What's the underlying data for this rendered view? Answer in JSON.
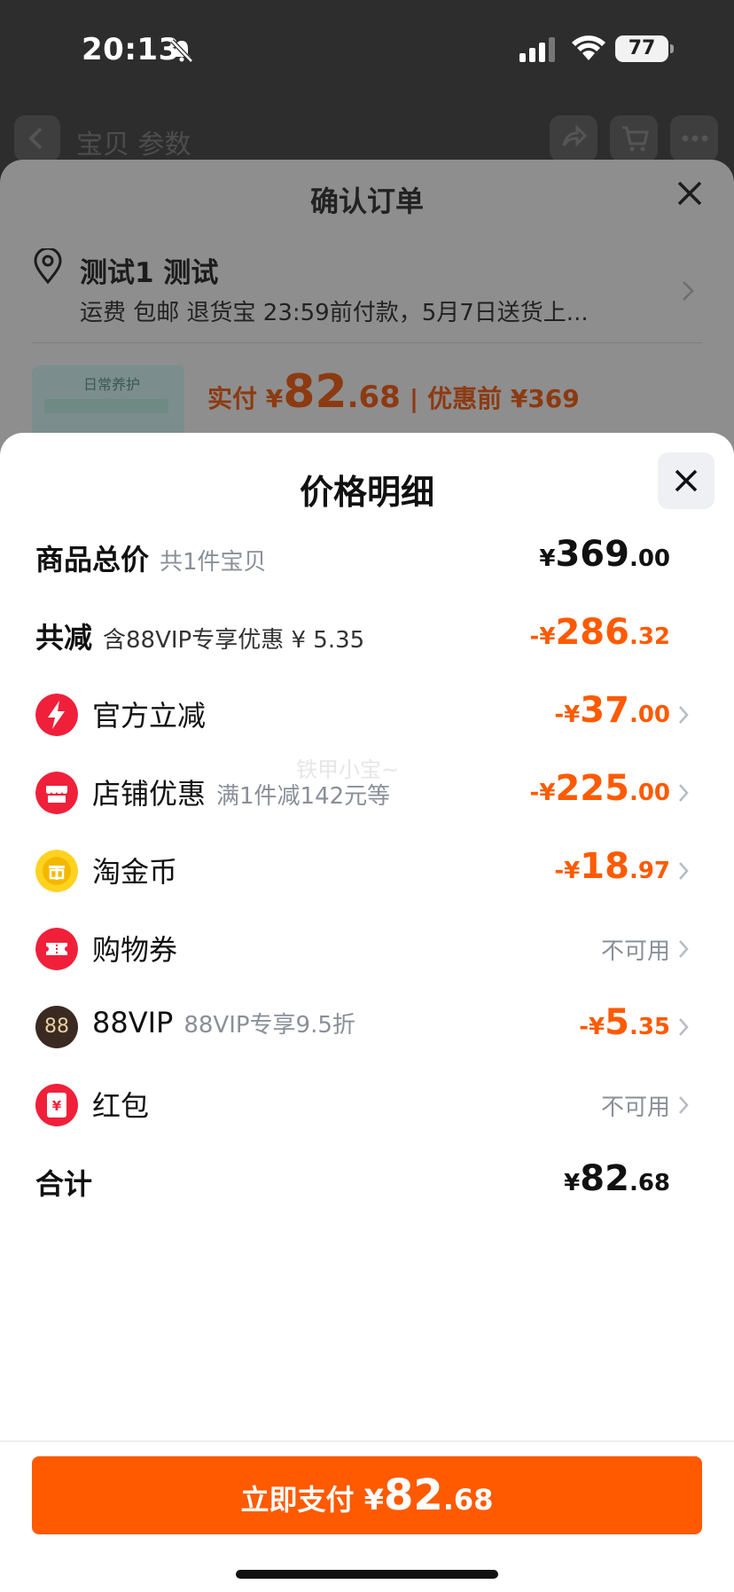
{
  "status_bar": {
    "time": "20:13",
    "battery": "77"
  },
  "background": {
    "tabs_text": "宝贝 参数",
    "sheet_title": "确认订单",
    "address_name": "测试1 测试",
    "address_sub": "运费 包邮 退货宝 23:59前付款，5月7日送货上...",
    "product_thumb_text": "日常养护",
    "paid_label": "实付 ¥",
    "paid_int": "82",
    "paid_dec": ".68",
    "paid_sep": "|",
    "paid_before": "优惠前 ¥369"
  },
  "sheet": {
    "title": "价格明细",
    "rows": [
      {
        "label": "商品总价",
        "sub": "共1件宝贝",
        "value_sym": "¥",
        "value_int": "369",
        "value_dec": ".00"
      },
      {
        "label": "共减",
        "sub": "含88VIP专享优惠 ¥ 5.35",
        "value_sym": "-¥",
        "value_int": "286",
        "value_dec": ".32"
      },
      {
        "label": "官方立减",
        "sub": "",
        "value_sym": "-¥",
        "value_int": "37",
        "value_dec": ".00",
        "icon": "lightning-icon"
      },
      {
        "label": "店铺优惠",
        "sub": "满1件减142元等",
        "value_sym": "-¥",
        "value_int": "225",
        "value_dec": ".00",
        "icon": "shop-icon"
      },
      {
        "label": "淘金币",
        "sub": "",
        "value_sym": "-¥",
        "value_int": "18",
        "value_dec": ".97",
        "icon": "gold-coin-icon"
      },
      {
        "label": "购物券",
        "sub": "",
        "value_text": "不可用",
        "icon": "coupon-icon"
      },
      {
        "label": "88VIP",
        "sub": "88VIP专享9.5折",
        "value_sym": "-¥",
        "value_int": "5",
        "value_dec": ".35",
        "icon": "vip88-icon",
        "icon_text": "88"
      },
      {
        "label": "红包",
        "sub": "",
        "value_text": "不可用",
        "icon": "red-envelope-icon",
        "icon_text": "¥"
      },
      {
        "label": "合计",
        "sub": "",
        "value_sym": "¥",
        "value_int": "82",
        "value_dec": ".68"
      }
    ],
    "watermark": "铁甲小宝~"
  },
  "pay_button": {
    "label": "立即支付 ¥",
    "int": "82",
    "dec": ".68"
  },
  "colors": {
    "accent": "#ff5a00",
    "text": "#111111",
    "muted": "#8a8f98"
  }
}
